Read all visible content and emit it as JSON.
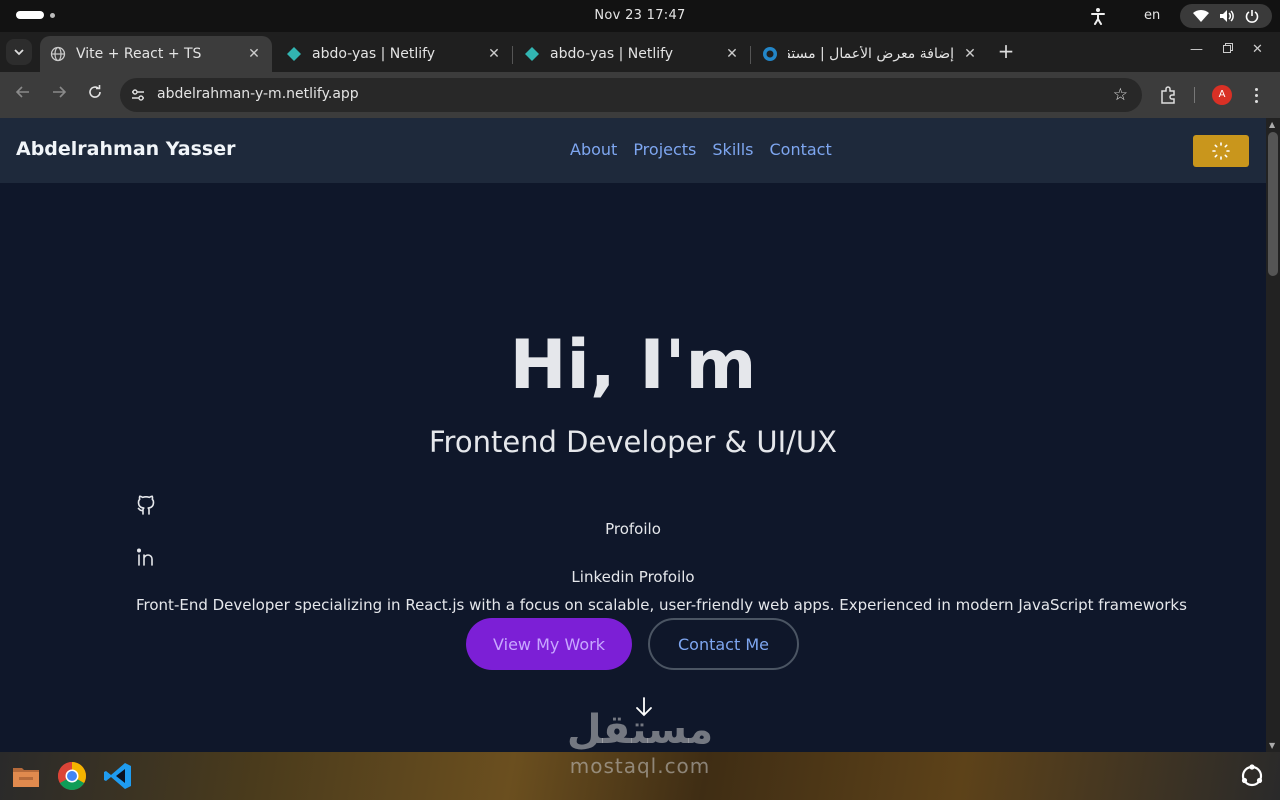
{
  "os": {
    "clock": "Nov 23  17:47",
    "language": "en"
  },
  "browser": {
    "tabs": [
      {
        "title": "Vite + React + TS",
        "active": true
      },
      {
        "title": "abdo-yas | Netlify",
        "active": false
      },
      {
        "title": "abdo-yas | Netlify",
        "active": false
      },
      {
        "title": "إضافة معرض الأعمال | مستقل",
        "active": false
      }
    ],
    "url": "abdelrahman-y-m.netlify.app",
    "profile_initial": "A"
  },
  "site": {
    "brand": "Abdelrahman Yasser",
    "nav": [
      "About",
      "Projects",
      "Skills",
      "Contact"
    ],
    "hero": {
      "title": "Hi, I'm",
      "subtitle": "Frontend Developer & UI/UX",
      "github_label": "Profoilo",
      "linkedin_label": "Linkedin Profoilo",
      "description": "Front-End Developer specializing in React.js with a focus on scalable, user-friendly web apps. Experienced in modern JavaScript frameworks",
      "primary_button": "View My Work",
      "secondary_button": "Contact Me"
    },
    "colors": {
      "nav_bg": "#1e293b",
      "page_bg": "#0f172a",
      "link": "#7ea6f0",
      "primary": "#7c1fd6",
      "theme_toggle": "#c9961c"
    }
  },
  "watermark": {
    "arabic": "مستقل",
    "latin": "mostaql.com"
  },
  "taskbar": {
    "apps": [
      "files-icon",
      "chrome-icon",
      "vscode-icon"
    ]
  }
}
